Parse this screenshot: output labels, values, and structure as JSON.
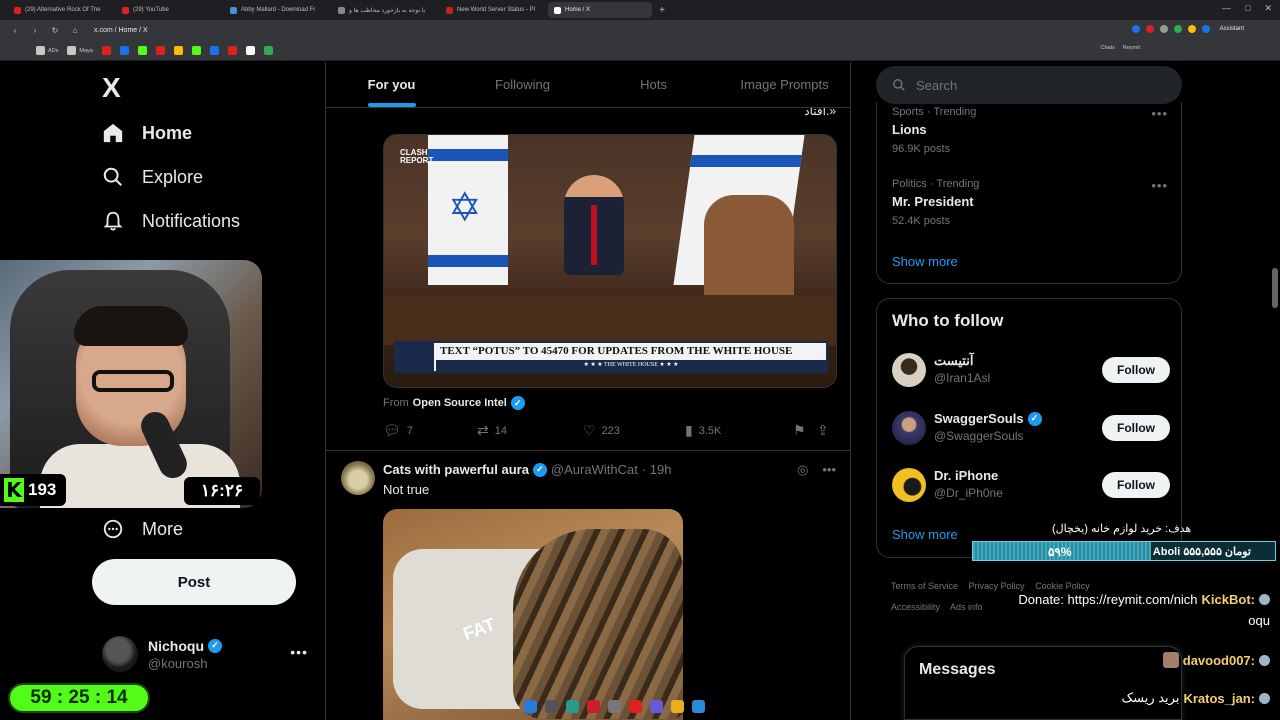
{
  "browser": {
    "tabs": [
      {
        "label": "(29) Alternative Rock Of The",
        "color": "#e02020"
      },
      {
        "label": "(29) YouTube",
        "color": "#e02020"
      },
      {
        "label": "Abby Mallard - Download Fr",
        "color": "#4a90d9"
      },
      {
        "label": "یا توجه به بازخورد مخاطب ها و",
        "color": "#888888"
      },
      {
        "label": "New World Server Status - Pl",
        "color": "#c02020"
      },
      {
        "label": "Home / X",
        "color": "#ffffff"
      }
    ],
    "url": "x.com / Home / X",
    "assistant": "Assistant",
    "bookmarks": [
      "ADs",
      "Maya"
    ],
    "bookmarks_right": [
      "Chats",
      "Reymit"
    ]
  },
  "nav": {
    "logo": "X",
    "items": [
      "Home",
      "Explore",
      "Notifications"
    ],
    "more": "More",
    "post": "Post",
    "account_name": "Nichoqu",
    "account_handle": "@kourosh"
  },
  "timeline": {
    "tabs": [
      "For you",
      "Following",
      "Hots",
      "Image Prompts"
    ],
    "active_tab": "For you",
    "rtl_fragment": "افتاد.»",
    "tweet1": {
      "media_watermark": "CLASH REPORT",
      "media_banner": "TEXT “POTUS” TO 45470 FOR UPDATES FROM THE WHITE HOUSE",
      "media_banner_sub": "★ ★ ★ THE WHITE HOUSE ★ ★ ★",
      "from_label": "From",
      "from_source": "Open Source Intel",
      "replies": "7",
      "reposts": "14",
      "likes": "223",
      "views": "3.5K"
    },
    "tweet2": {
      "name": "Cats with pawerful aura",
      "handle": "@AuraWithCat",
      "time": "· 19h",
      "text": "Not true",
      "media_text": "FAT"
    }
  },
  "sidebar": {
    "search_placeholder": "Search",
    "trends": [
      {
        "meta": "Sports · Trending",
        "name": "Lions",
        "count": "96.9K posts"
      },
      {
        "meta": "Politics · Trending",
        "name": "Mr. President",
        "count": "52.4K posts"
      }
    ],
    "show_more": "Show more",
    "who_to_follow_title": "Who to follow",
    "follow_label": "Follow",
    "suggestions": [
      {
        "name": "آنتیست",
        "handle": "@Iran1Asl",
        "verified": false,
        "avatar_color": "#d8d0c0"
      },
      {
        "name": "SwaggerSouls",
        "handle": "@SwaggerSouls",
        "verified": true,
        "avatar_color": "#3a3a6a"
      },
      {
        "name": "Dr. iPhone",
        "handle": "@Dr_iPh0ne",
        "verified": false,
        "avatar_color": "#f0c020"
      }
    ],
    "footer": [
      "Terms of Service",
      "Privacy Policy",
      "Cookie Policy",
      "Accessibility",
      "Ads info"
    ],
    "messages": "Messages"
  },
  "stream": {
    "kick_count": "193",
    "clock": "۱۶:۲۶",
    "timer": "59 : 25 : 14",
    "goal_label": "هدف: خرید لوازم خانه (یخچال)",
    "goal_percent": "۵۹%",
    "goal_fraction": 0.59,
    "goal_donor": "Aboli ۵۵۵,۵۵۵ تومان",
    "chat": [
      {
        "user": "KickBot:",
        "text": "Donate: https://reymit.com/nich"
      },
      {
        "user": "",
        "text": "oqu"
      },
      {
        "user": "davood007:",
        "text": ""
      },
      {
        "user": "Kratos_jan:",
        "text": "برید ریسک"
      }
    ]
  }
}
